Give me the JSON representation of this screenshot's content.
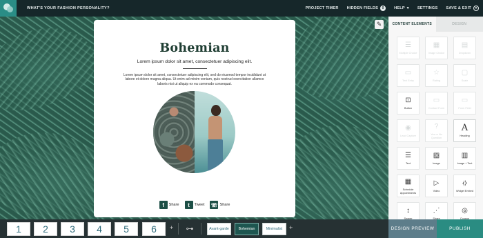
{
  "app": {
    "title": "WHAT'S YOUR FASHION PERSONALITY?"
  },
  "topnav": {
    "project_timer": "PROJECT TIMER",
    "hidden_fields": "HIDDEN FIELDS",
    "hidden_fields_count": "0",
    "help": "HELP",
    "help_caret": "▾",
    "settings": "SETTINGS",
    "save_exit": "SAVE & EXIT",
    "save_exit_icon": "✕"
  },
  "card": {
    "title": "Bohemian",
    "subtitle": "Lorem ipsum dolor sit amet, consectetuer adipiscing elit.",
    "body": "Lorem ipsum dolor sit amet, consectetuer adipiscing elit, sed do eiusmod tempor incididunt ut labore et dolore magna aliqua. Ut enim ad minim veniam, quis nostrud exercitation ullamco laboris nisi ut aliquip ex ea commodo consequat.",
    "shares": [
      {
        "icon": "facebook-icon",
        "glyph": "f",
        "label": "Share"
      },
      {
        "icon": "twitter-icon",
        "glyph": "t",
        "label": "Tweet"
      },
      {
        "icon": "whatsapp-icon",
        "glyph": "☏",
        "label": "Share"
      }
    ]
  },
  "panel": {
    "tabs": [
      "CONTENT ELEMENTS",
      "DESIGN"
    ],
    "tiles": [
      {
        "label": "Multiple Choice",
        "icon": "multiple-choice-icon",
        "glyph": "☰",
        "enabled": false
      },
      {
        "label": "Image Choice",
        "icon": "image-choice-icon",
        "glyph": "▦",
        "enabled": false
      },
      {
        "label": "Dropdown",
        "icon": "dropdown-icon",
        "glyph": "▤",
        "enabled": false
      },
      {
        "label": "Text Entry",
        "icon": "text-entry-icon",
        "glyph": "▭",
        "enabled": false
      },
      {
        "label": "Rating",
        "icon": "rating-icon",
        "glyph": "☆",
        "enabled": false
      },
      {
        "label": "Scale",
        "icon": "scale-icon",
        "glyph": "▢",
        "enabled": false
      },
      {
        "label": "Button",
        "icon": "button-icon",
        "glyph": "⊡",
        "enabled": true
      },
      {
        "label": "Contact Form",
        "icon": "contact-form-icon",
        "glyph": "▭",
        "enabled": false
      },
      {
        "label": "Form Field",
        "icon": "form-field-icon",
        "glyph": "▭",
        "enabled": false
      },
      {
        "label": "Lead Capture",
        "icon": "eye-icon",
        "glyph": "◉",
        "enabled": false
      },
      {
        "label": "Yes or No Question",
        "icon": "yes-no-icon",
        "glyph": "?",
        "enabled": false
      },
      {
        "label": "Heading",
        "icon": "heading-icon",
        "glyph": "A",
        "enabled": true
      },
      {
        "label": "Text",
        "icon": "text-icon",
        "glyph": "☰",
        "enabled": true
      },
      {
        "label": "Image",
        "icon": "image-icon",
        "glyph": "▨",
        "enabled": true
      },
      {
        "label": "Image + Text",
        "icon": "image-text-icon",
        "glyph": "▥",
        "enabled": true
      },
      {
        "label": "Schedule Appointments",
        "icon": "calendar-icon",
        "glyph": "▦",
        "enabled": true
      },
      {
        "label": "Video",
        "icon": "video-icon",
        "glyph": "▷",
        "enabled": true
      },
      {
        "label": "Widget Embed",
        "icon": "embed-icon",
        "glyph": "⧼⧽",
        "enabled": true
      },
      {
        "label": "Spacer",
        "icon": "spacer-icon",
        "glyph": "↕",
        "enabled": true
      },
      {
        "label": "Share",
        "icon": "share-icon",
        "glyph": "⋰",
        "enabled": true
      },
      {
        "label": "Coupon",
        "icon": "coupon-icon",
        "glyph": "◎",
        "enabled": true
      }
    ]
  },
  "bottom": {
    "pages": [
      "1",
      "2",
      "3",
      "4",
      "5",
      "6"
    ],
    "plus": "+",
    "results": [
      "Avant-garde",
      "Bohemian",
      "Minimalist"
    ],
    "active_result": "Bohemian",
    "design_preview": "DESIGN PREVIEW",
    "publish": "PUBLISH"
  },
  "colors": {
    "accent": "#2a8c82",
    "topbar": "#16272a",
    "heading": "#1e3d32"
  }
}
